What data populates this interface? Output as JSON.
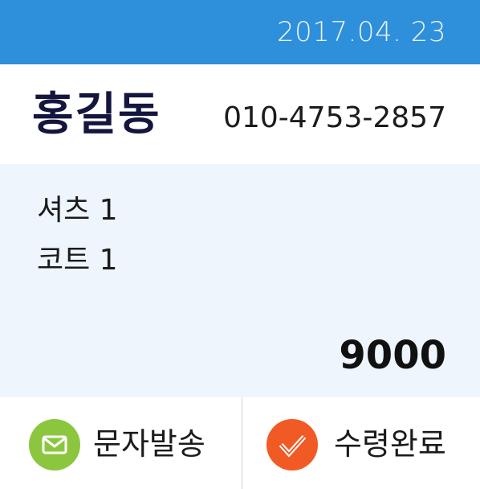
{
  "header": {
    "date": "2017.04. 23"
  },
  "customer": {
    "name": "홍길동",
    "phone": "010-4753-2857"
  },
  "order": {
    "items": [
      "셔츠 1",
      "코트 1"
    ],
    "total": "9000"
  },
  "actions": {
    "sms": {
      "label": "문자발송",
      "icon": "mail-icon",
      "color": "#8cc63f"
    },
    "pickup": {
      "label": "수령완료",
      "icon": "check-icon",
      "color": "#f15a24"
    }
  },
  "colors": {
    "header_bar": "#2e8fdb",
    "order_panel": "#eef5fd",
    "name_text": "#14163e"
  }
}
